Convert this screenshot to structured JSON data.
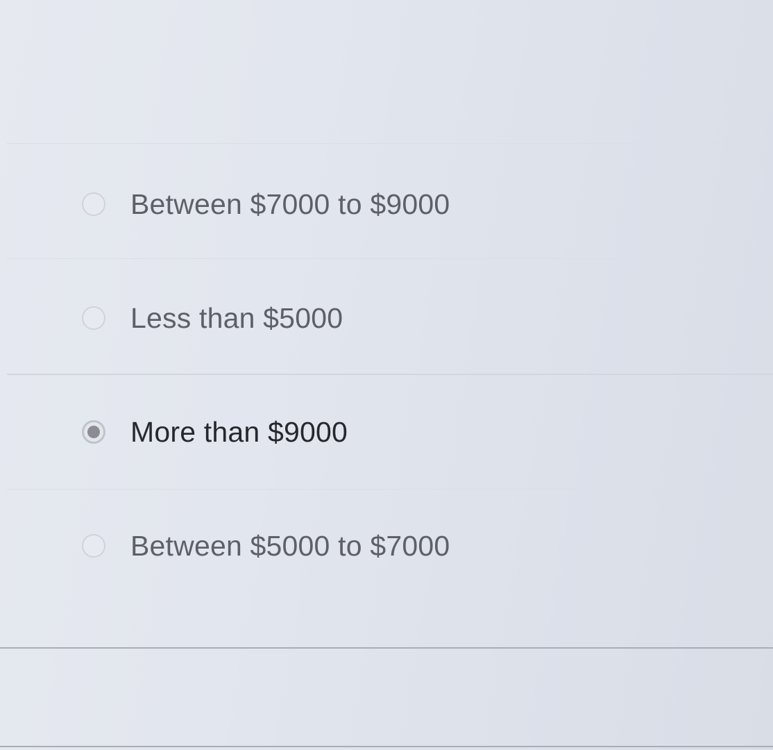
{
  "question": {
    "options": [
      {
        "label": "Between $7000 to $9000",
        "selected": false
      },
      {
        "label": "Less than $5000",
        "selected": false
      },
      {
        "label": "More than $9000",
        "selected": true
      },
      {
        "label": "Between $5000 to $7000",
        "selected": false
      }
    ],
    "selected_value": "More than $9000"
  },
  "colors": {
    "background": "#e2e6ee",
    "text_default": "#5d6069",
    "text_selected": "#26282d",
    "radio_fill": "#8a8d93"
  }
}
